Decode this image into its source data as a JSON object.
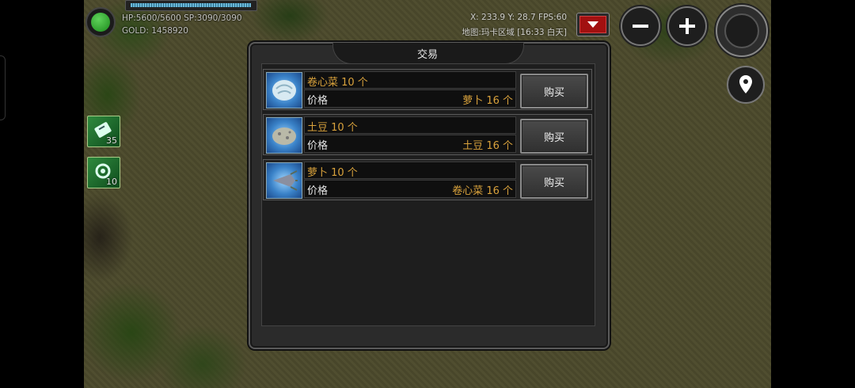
{
  "hud": {
    "hp_sp": "HP:5600/5600  SP:3090/3090",
    "gold": "GOLD: 1458920",
    "hp_fill": 1.0,
    "coords": "X: 233.9 Y: 28.7  FPS:60",
    "map_location": "地图:玛卡区域 [16:33 白天]"
  },
  "skills": [
    {
      "icon": "skill-scroll-icon",
      "count": "35"
    },
    {
      "icon": "skill-gear-icon",
      "count": "10"
    }
  ],
  "dialog": {
    "title": "交易",
    "items": [
      {
        "icon": "cabbage-icon",
        "name": "卷心菜 10 个",
        "price_label": "价格",
        "price": "萝卜 16 个",
        "buy_label": "购买"
      },
      {
        "icon": "potato-icon",
        "name": "土豆 10 个",
        "price_label": "价格",
        "price": "土豆 16 个",
        "buy_label": "购买"
      },
      {
        "icon": "radish-icon",
        "name": "萝卜 10 个",
        "price_label": "价格",
        "price": "卷心菜 16 个",
        "buy_label": "购买"
      }
    ]
  },
  "colors": {
    "item_text": "#d9a23c",
    "status_orb": "#2fb02f",
    "dropdown": "#a21010"
  }
}
